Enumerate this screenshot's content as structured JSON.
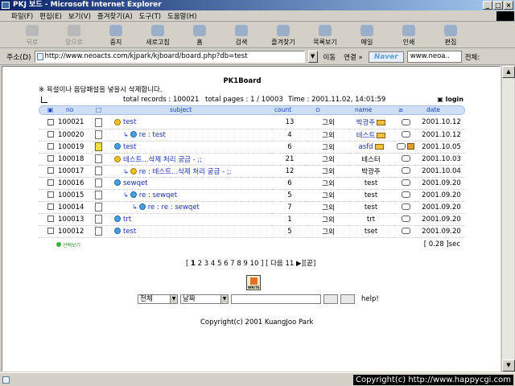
{
  "window": {
    "title": "PKJ 보드 - Microsoft Internet Explorer"
  },
  "menu": [
    "파일(F)",
    "편집(E)",
    "보기(V)",
    "즐겨찾기(A)",
    "도구(T)",
    "도움말(H)"
  ],
  "toolbar": [
    {
      "label": "뒤로",
      "icon": "back-arrow-icon",
      "enabled": false
    },
    {
      "label": "앞으로",
      "icon": "forward-arrow-icon",
      "enabled": false
    },
    {
      "label": "중지",
      "icon": "stop-icon",
      "enabled": true
    },
    {
      "label": "새로고침",
      "icon": "refresh-icon",
      "enabled": true
    },
    {
      "label": "홈",
      "icon": "home-icon",
      "enabled": true
    },
    {
      "label": "검색",
      "icon": "search-icon",
      "enabled": true
    },
    {
      "label": "즐겨찾기",
      "icon": "favorites-icon",
      "enabled": true
    },
    {
      "label": "목록보기",
      "icon": "history-icon",
      "enabled": true
    },
    {
      "label": "메일",
      "icon": "mail-icon",
      "enabled": true
    },
    {
      "label": "인쇄",
      "icon": "print-icon",
      "enabled": true
    },
    {
      "label": "편집",
      "icon": "edit-icon",
      "enabled": true
    }
  ],
  "address": {
    "label": "주소(D)",
    "url": "http://www.neoacts.com/kjpark/kjboard/board.php?db=test",
    "go": "이동",
    "links": "연결 »",
    "naver": "Naver",
    "search_value": "www.neoa..",
    "search_scope": "전체:"
  },
  "board": {
    "title": "PK1Board",
    "warning": "※ 욕설이나 음담패설을 넣을시 삭제합니다.",
    "total_records": "total records : 100021",
    "total_pages": "total pages : 1 / 10003",
    "time": "Time : 2001.11.02, 14:01:59",
    "login": "login",
    "columns": {
      "no": "no",
      "subject": "subject",
      "count": "count",
      "name": "name",
      "date": "date"
    },
    "rows": [
      {
        "no": "100021",
        "subject": "test",
        "depth": 0,
        "hot": true,
        "special": false,
        "count": "13",
        "status": "그외",
        "name": "박광주",
        "name_link": true,
        "mail": true,
        "home": false,
        "date": "2001.10.12"
      },
      {
        "no": "100020",
        "subject": "re : test",
        "depth": 1,
        "hot": false,
        "special": false,
        "count": "4",
        "status": "그외",
        "name": "테스트",
        "name_link": true,
        "mail": true,
        "home": false,
        "date": "2001.10.12"
      },
      {
        "no": "100019",
        "subject": "test",
        "depth": 0,
        "hot": false,
        "special": true,
        "count": "6",
        "status": "그외",
        "name": "asfd",
        "name_link": true,
        "mail": true,
        "home": true,
        "date": "2001.10.05"
      },
      {
        "no": "100018",
        "subject": "테스트...삭제 처리 궁금 - ;;",
        "depth": 0,
        "hot": true,
        "special": false,
        "count": "21",
        "status": "그외",
        "name": "테스터",
        "name_link": false,
        "mail": false,
        "home": false,
        "date": "2001.10.03"
      },
      {
        "no": "100017",
        "subject": "re : 테스트...삭제 처리 궁금 - ;;",
        "depth": 1,
        "hot": true,
        "special": false,
        "count": "12",
        "status": "그외",
        "name": "박광주",
        "name_link": false,
        "mail": false,
        "home": false,
        "date": "2001.10.04"
      },
      {
        "no": "100016",
        "subject": "sewqet",
        "depth": 0,
        "hot": false,
        "special": false,
        "count": "6",
        "status": "그외",
        "name": "test",
        "name_link": false,
        "mail": false,
        "home": false,
        "date": "2001.09.20"
      },
      {
        "no": "100015",
        "subject": "re : sewqet",
        "depth": 1,
        "hot": false,
        "special": false,
        "count": "5",
        "status": "그외",
        "name": "test",
        "name_link": false,
        "mail": false,
        "home": false,
        "date": "2001.09.20"
      },
      {
        "no": "100014",
        "subject": "re : re : sewqet",
        "depth": 2,
        "hot": false,
        "special": false,
        "count": "7",
        "status": "그외",
        "name": "test",
        "name_link": false,
        "mail": false,
        "home": false,
        "date": "2001.09.20"
      },
      {
        "no": "100013",
        "subject": "trt",
        "depth": 0,
        "hot": false,
        "special": false,
        "count": "1",
        "status": "그외",
        "name": "trt",
        "name_link": false,
        "mail": false,
        "home": false,
        "date": "2001.09.20"
      },
      {
        "no": "100012",
        "subject": "test",
        "depth": 0,
        "hot": false,
        "special": false,
        "count": "5",
        "status": "그외",
        "name": "tset",
        "name_link": false,
        "mail": false,
        "home": false,
        "date": "2001.09.20"
      }
    ],
    "select_view": "선택보기",
    "elapsed": "[ 0.28 ]sec",
    "pager": {
      "open": "[",
      "current": "1",
      "pages": "2 3 4 5 6 7 8 9 10",
      "close": "] [ 다음 11",
      "last": "▶][끝]"
    },
    "write_label": "WRITE",
    "search": {
      "scope": "전체",
      "field": "날짜",
      "help": "help!"
    },
    "copyright": "Copyright(c) 2001 KuangJoo Park"
  },
  "status_overlay": "Copyright(c) http://www.happycgi.com"
}
